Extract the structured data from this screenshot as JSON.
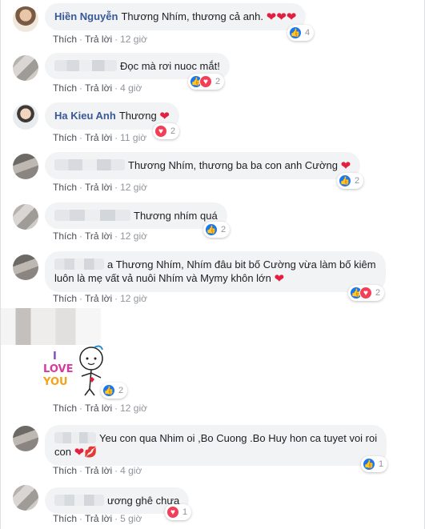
{
  "actions": {
    "like": "Thích",
    "reply": "Trả lời",
    "sep": "·"
  },
  "colors": {
    "name": "#385898",
    "bubble": "#f2f3f5",
    "like": "#1877f2",
    "love": "#f33e58"
  },
  "comments": [
    {
      "name": "Hiền Nguyễn",
      "text": "Thương Nhím, thương cả anh.",
      "time": "12 giờ",
      "reactions": [
        "like"
      ],
      "count": "4"
    },
    {
      "name": "",
      "text": "Đọc mà rơi nuoc mắt!",
      "time": "4 giờ",
      "reactions": [
        "like",
        "love"
      ],
      "count": "2"
    },
    {
      "name": "Ha Kieu Anh",
      "text": "Thương",
      "time": "11 giờ",
      "reactions": [
        "love"
      ],
      "count": "2"
    },
    {
      "name": "",
      "text": "Thương Nhím, thương ba ba con anh Cường",
      "time": "12 giờ",
      "reactions": [
        "like"
      ],
      "count": "2"
    },
    {
      "name": "",
      "text": "Thương nhím quá",
      "time": "12 giờ",
      "reactions": [
        "like"
      ],
      "count": "2"
    },
    {
      "name": "",
      "text": "a Thương Nhím, Nhím đâu bit bố Cường vừa làm bố kiêm",
      "text2": "luôn là mẹ vất vả nuôi Nhím và Mymy khôn lớn",
      "time": "12 giờ",
      "reactions": [
        "like",
        "love"
      ],
      "count": "2"
    },
    {
      "name": "",
      "sticker": [
        "I",
        "LOVE",
        "YOU"
      ],
      "time": "12 giờ",
      "reactions": [
        "like"
      ],
      "count": "2"
    },
    {
      "name": "",
      "text": "Yeu con qua Nhim oi ,Bo Cuong .Bo Huy hon ca tuyet voi roi",
      "text2": "con",
      "time": "4 giờ",
      "reactions": [
        "like"
      ],
      "count": "1"
    },
    {
      "name": "",
      "text": "ương ghê chưa",
      "time": "5 giờ",
      "reactions": [
        "love"
      ],
      "count": "1"
    }
  ]
}
